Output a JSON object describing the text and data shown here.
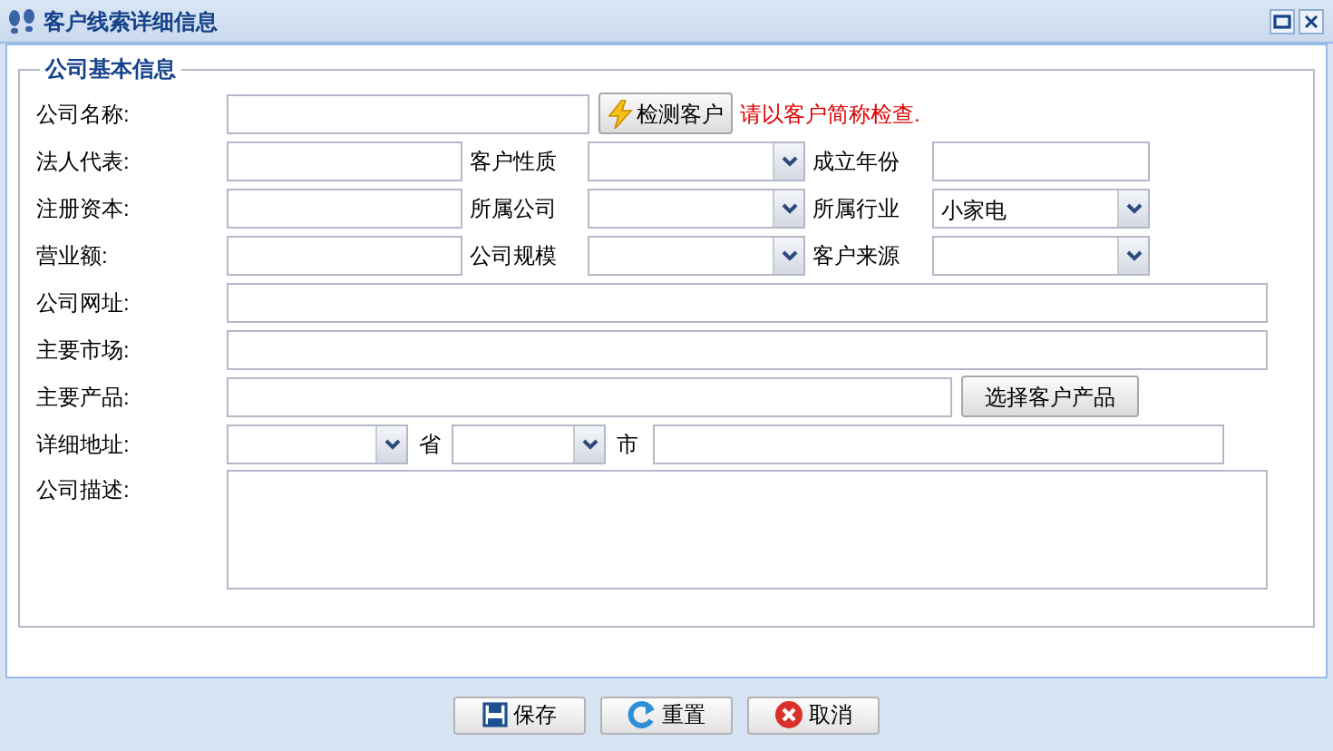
{
  "window": {
    "title": "客户线索详细信息"
  },
  "fieldset": {
    "legend": "公司基本信息"
  },
  "rows": [
    {
      "kind": "name",
      "label": "公司名称:",
      "cells": [
        {
          "kind": "text"
        },
        {
          "kind": "button",
          "text": "检测客户"
        },
        {
          "kind": "note",
          "text": "请以客户简称检查."
        }
      ]
    },
    {
      "kind": "triple",
      "label": "法人代表:",
      "cells": [
        {
          "kind": "text"
        },
        {
          "kind": "label",
          "text": "客户性质"
        },
        {
          "kind": "select"
        },
        {
          "kind": "label",
          "text": "成立年份"
        },
        {
          "kind": "text"
        }
      ]
    },
    {
      "kind": "triple",
      "label": "注册资本:",
      "cells": [
        {
          "kind": "text"
        },
        {
          "kind": "label",
          "text": "所属公司"
        },
        {
          "kind": "select"
        },
        {
          "kind": "label",
          "text": "所属行业"
        },
        {
          "kind": "select",
          "value": "小家电"
        }
      ]
    },
    {
      "kind": "triple",
      "label": "营业额:",
      "cells": [
        {
          "kind": "text"
        },
        {
          "kind": "label",
          "text": "公司规模"
        },
        {
          "kind": "select"
        },
        {
          "kind": "label",
          "text": "客户来源"
        },
        {
          "kind": "select"
        }
      ]
    },
    {
      "kind": "full",
      "label": "公司网址:",
      "cells": [
        {
          "kind": "text"
        }
      ]
    },
    {
      "kind": "full",
      "label": "主要市场:",
      "cells": [
        {
          "kind": "text"
        }
      ]
    },
    {
      "kind": "product",
      "label": "主要产品:",
      "cells": [
        {
          "kind": "text"
        },
        {
          "kind": "button",
          "text": "选择客户产品"
        }
      ]
    },
    {
      "kind": "address",
      "label": "详细地址:",
      "cells": [
        {
          "kind": "select"
        },
        {
          "kind": "label",
          "text": "省"
        },
        {
          "kind": "select"
        },
        {
          "kind": "label",
          "text": "市"
        },
        {
          "kind": "text"
        }
      ]
    },
    {
      "kind": "textarea",
      "label": "公司描述:",
      "cells": [
        {
          "kind": "textarea"
        }
      ]
    }
  ],
  "buttons": [
    {
      "kind": "save",
      "text": "保存"
    },
    {
      "kind": "reset",
      "text": "重置"
    },
    {
      "kind": "cancel",
      "text": "取消"
    }
  ]
}
